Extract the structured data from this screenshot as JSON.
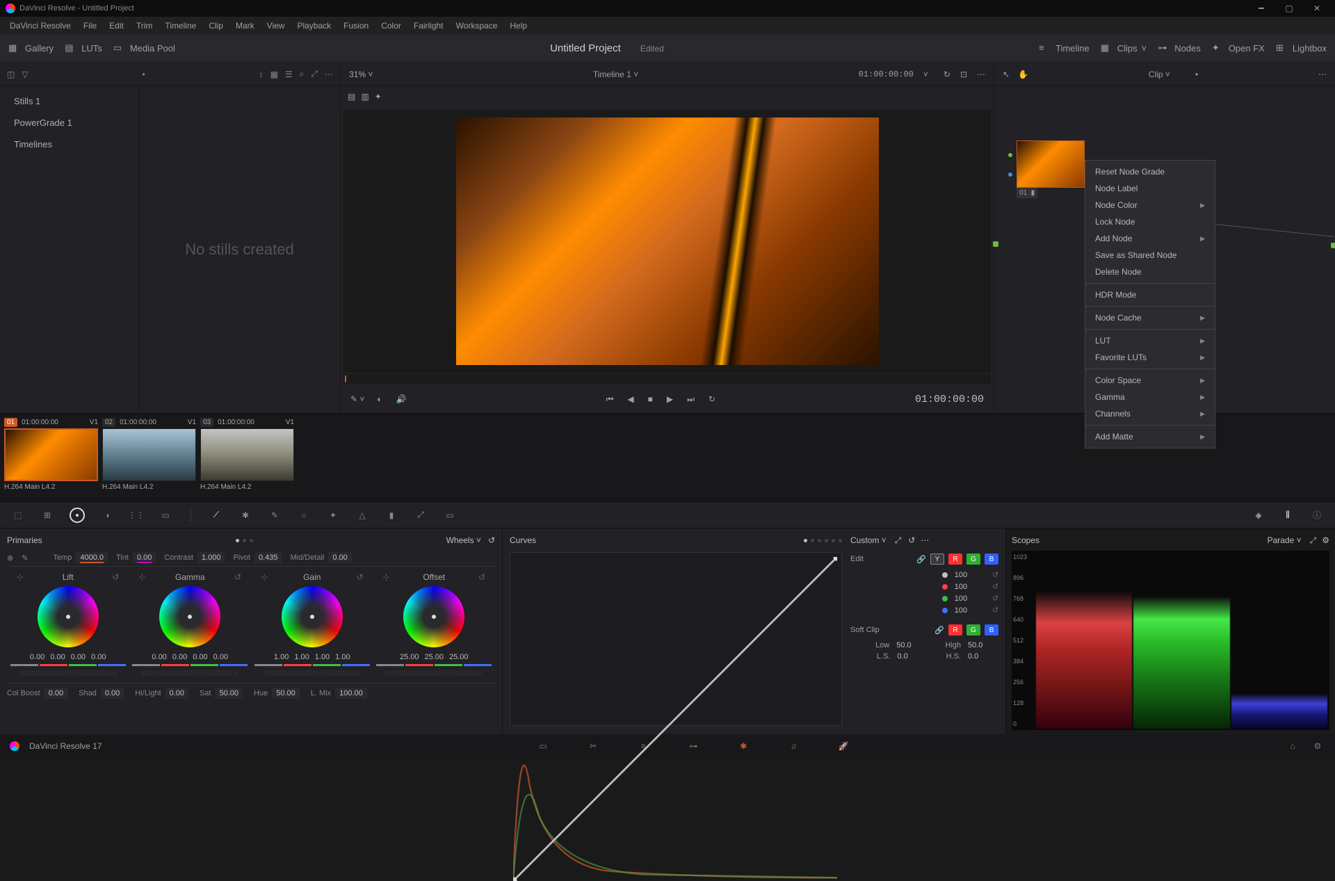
{
  "window": {
    "title": "DaVinci Resolve - Untitled Project"
  },
  "menus": [
    "DaVinci Resolve",
    "File",
    "Edit",
    "Trim",
    "Timeline",
    "Clip",
    "Mark",
    "View",
    "Playback",
    "Fusion",
    "Color",
    "Fairlight",
    "Workspace",
    "Help"
  ],
  "toolbar": {
    "gallery": "Gallery",
    "luts": "LUTs",
    "mediapool": "Media Pool",
    "timeline": "Timeline",
    "clips": "Clips",
    "nodes": "Nodes",
    "openfx": "Open FX",
    "lightbox": "Lightbox",
    "project_name": "Untitled Project",
    "project_status": "Edited"
  },
  "gallery_panel": {
    "stills": "Stills 1",
    "powergrade": "PowerGrade 1",
    "timelines": "Timelines",
    "empty_msg": "No stills created"
  },
  "viewer": {
    "zoom": "31%",
    "timeline_name": "Timeline 1",
    "timecode_head": "01:00:00:00",
    "timecode_play": "01:00:00:00"
  },
  "node_panel": {
    "clip_label": "Clip",
    "node_num": "01"
  },
  "context_menu": {
    "items": [
      {
        "label": "Reset Node Grade",
        "sub": false
      },
      {
        "label": "Node Label",
        "sub": false
      },
      {
        "label": "Node Color",
        "sub": true
      },
      {
        "label": "Lock Node",
        "sub": false
      },
      {
        "label": "Add Node",
        "sub": true
      },
      {
        "label": "Save as Shared Node",
        "sub": false
      },
      {
        "label": "Delete Node",
        "sub": false
      },
      {
        "sep": true
      },
      {
        "label": "HDR Mode",
        "sub": false
      },
      {
        "sep": true
      },
      {
        "label": "Node Cache",
        "sub": true
      },
      {
        "sep": true
      },
      {
        "label": "LUT",
        "sub": true
      },
      {
        "label": "Favorite LUTs",
        "sub": true
      },
      {
        "sep": true
      },
      {
        "label": "Color Space",
        "sub": true
      },
      {
        "label": "Gamma",
        "sub": true
      },
      {
        "label": "Channels",
        "sub": true
      },
      {
        "sep": true
      },
      {
        "label": "Add Matte",
        "sub": true
      }
    ]
  },
  "clips": [
    {
      "num": "01",
      "tc": "01:00:00:00",
      "track": "V1",
      "name": "H.264 Main L4.2",
      "sel": true,
      "bg": "linear-gradient(135deg,#2a1200,#ff8c00 40%,#8b3a00)"
    },
    {
      "num": "02",
      "tc": "01:00:00:00",
      "track": "V1",
      "name": "H.264 Main L4.2",
      "sel": false,
      "bg": "linear-gradient(#a8c4d4,#5a7a8a 55%,#2a3a42)"
    },
    {
      "num": "03",
      "tc": "01:00:00:00",
      "track": "V1",
      "name": "H.264 Main L4.2",
      "sel": false,
      "bg": "linear-gradient(#c4c4c4,#8a8a7a 50%,#3a3a32)"
    }
  ],
  "primaries": {
    "title": "Primaries",
    "mode": "Wheels",
    "temp_l": "Temp",
    "temp": "4000.0",
    "tint_l": "Tint",
    "tint": "0.00",
    "contrast_l": "Contrast",
    "contrast": "1.000",
    "pivot_l": "Pivot",
    "pivot": "0.435",
    "md_l": "Mid/Detail",
    "md": "0.00",
    "wheels": [
      {
        "name": "Lift",
        "v": [
          "0.00",
          "0.00",
          "0.00",
          "0.00"
        ]
      },
      {
        "name": "Gamma",
        "v": [
          "0.00",
          "0.00",
          "0.00",
          "0.00"
        ]
      },
      {
        "name": "Gain",
        "v": [
          "1.00",
          "1.00",
          "1.00",
          "1.00"
        ]
      },
      {
        "name": "Offset",
        "v": [
          "25.00",
          "25.00",
          "25.00"
        ]
      }
    ],
    "row3": {
      "colboost_l": "Col Boost",
      "colboost": "0.00",
      "shad_l": "Shad",
      "shad": "0.00",
      "hilight_l": "Hi/Light",
      "hilight": "0.00",
      "sat_l": "Sat",
      "sat": "50.00",
      "hue_l": "Hue",
      "hue": "50.00",
      "lmix_l": "L. Mix",
      "lmix": "100.00"
    }
  },
  "curves": {
    "title": "Curves",
    "mode": "Custom",
    "edit_l": "Edit",
    "channels": [
      {
        "c": "#c0c0c0",
        "v": "100"
      },
      {
        "c": "#ff4040",
        "v": "100"
      },
      {
        "c": "#40c040",
        "v": "100"
      },
      {
        "c": "#4070ff",
        "v": "100"
      }
    ],
    "softclip_l": "Soft Clip",
    "low_l": "Low",
    "low": "50.0",
    "high_l": "High",
    "high": "50.0",
    "ls_l": "L.S.",
    "ls": "0.0",
    "hs_l": "H.S.",
    "hs": "0.0"
  },
  "scopes": {
    "title": "Scopes",
    "mode": "Parade",
    "ticks": [
      "1023",
      "896",
      "768",
      "640",
      "512",
      "384",
      "256",
      "128",
      "0"
    ]
  },
  "footer": {
    "app": "DaVinci Resolve 17"
  }
}
